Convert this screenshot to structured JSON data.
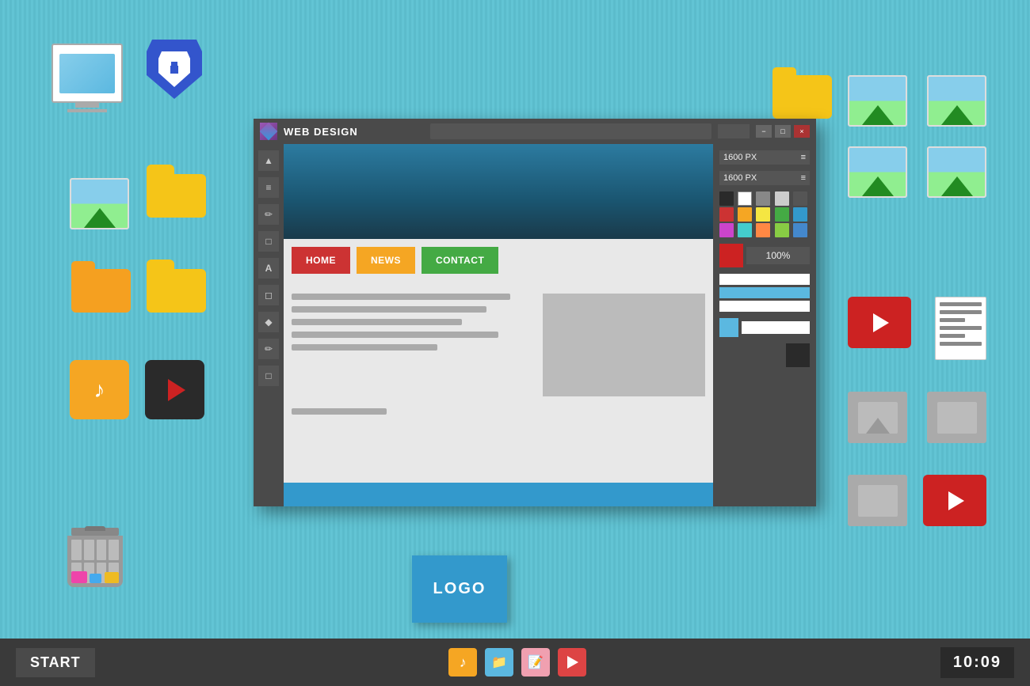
{
  "background": {
    "color": "#5bbccc"
  },
  "taskbar": {
    "start_label": "START",
    "time": "10:09",
    "icons": [
      {
        "name": "music",
        "color": "#f5a623"
      },
      {
        "name": "folder",
        "color": "#5bb8e0"
      },
      {
        "name": "note",
        "color": "#f0a0b0"
      },
      {
        "name": "play",
        "color": "#cc2222"
      }
    ]
  },
  "app_window": {
    "title": "WEB DESIGN",
    "icon": "◈",
    "controls": [
      "−",
      "□",
      "×"
    ],
    "zoom_value": "100%",
    "size_labels": [
      "1600 PX",
      "1600 PX"
    ],
    "toolbar_tools": [
      "▲",
      "≡",
      "✏",
      "□",
      "A",
      "□",
      "◆",
      "✏",
      "□"
    ],
    "swatches": [
      "#2a2a2a",
      "#ffffff",
      "#888888",
      "#cccccc",
      "#555555",
      "#cc3333",
      "#f5a623",
      "#f5e642",
      "#44aa44",
      "#3399cc",
      "#cc44cc",
      "#44cccc",
      "#ff8844",
      "#88cc44",
      "#4488cc"
    ],
    "nav_buttons": [
      {
        "label": "HOME",
        "color": "#cc3333"
      },
      {
        "label": "NEWS",
        "color": "#f5a623"
      },
      {
        "label": "CONTACT",
        "color": "#44aa44"
      }
    ],
    "logo_label": "LOGO"
  },
  "desktop_icons": {
    "folders": [
      "yellow folder",
      "yellow folder",
      "yellow folder",
      "orange folder"
    ],
    "images": [
      "landscape photo",
      "landscape photo",
      "landscape photo",
      "gray image",
      "gray image"
    ],
    "music": "music note",
    "play_buttons": [
      "dark play",
      "red play 1",
      "red play 2"
    ],
    "document": "text document",
    "computer": "computer monitor",
    "shield": "shield icon",
    "trash": "recycle bin"
  }
}
